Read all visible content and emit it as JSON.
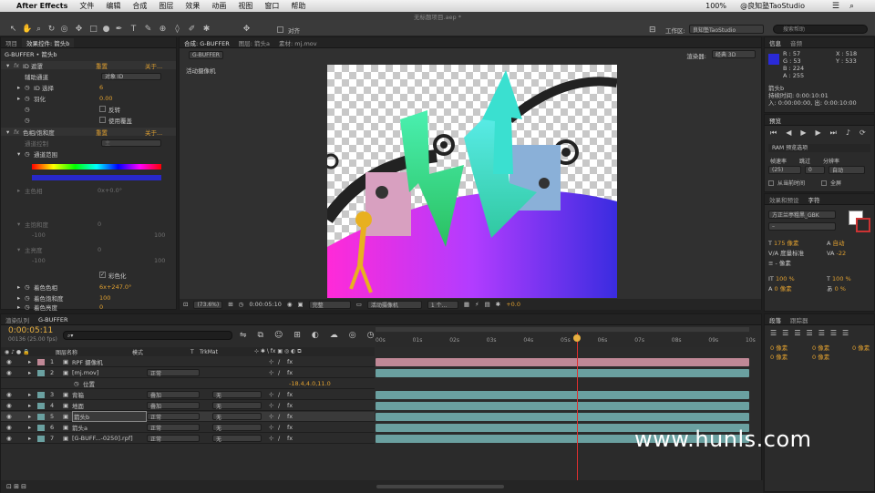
{
  "menubar": {
    "app": "After Effects",
    "items": [
      "文件",
      "编辑",
      "合成",
      "图层",
      "效果",
      "动画",
      "视图",
      "窗口",
      "帮助"
    ],
    "title": "无标题项目.aep *",
    "user": "@良知塾TaoStudio",
    "battery": "100%"
  },
  "toolbar": {
    "align_label": "对齐",
    "workspace_label": "工作区:",
    "workspace_value": "良知塾TaoStudio",
    "search_placeholder": "搜索帮助"
  },
  "effect_panel": {
    "tabs": [
      "项目",
      "效果控件: 箭头b"
    ],
    "breadcrumb": "G-BUFFER • 箭头b",
    "effects": [
      {
        "name": "ID 遮罩",
        "reset": "重置",
        "about": "关于..."
      },
      {
        "name": "色相/饱和度",
        "reset": "重置",
        "about": "关于..."
      }
    ],
    "id_matte": {
      "aux_channel_label": "辅助通道",
      "aux_channel_value": "对象 ID",
      "id_select_label": "ID 选择",
      "id_select_value": "6",
      "feather_label": "羽化",
      "feather_value": "0.00",
      "invert_label": "反转",
      "use_coverage_label": "使用覆盖"
    },
    "hue": {
      "channel_control_label": "通道控制",
      "channel_control_value": "主",
      "channel_range_label": "通道范围",
      "master_hue_label": "主色相",
      "master_hue_value": "0x+0.0°",
      "master_sat_label": "主饱和度",
      "master_sat_value": "0",
      "master_light_label": "主亮度",
      "master_light_value": "0",
      "scale_min": "-100",
      "scale_max": "100",
      "colorize_label": "彩色化",
      "colorize_hue_label": "着色色相",
      "colorize_hue_value": "6x+247.0°",
      "colorize_sat_label": "着色饱和度",
      "colorize_sat_value": "100",
      "colorize_light_label": "着色亮度",
      "colorize_light_value": "0"
    }
  },
  "comp_panel": {
    "tabs": [
      "合成: G-BUFFER",
      "图层: 箭头a",
      "素材: mj.mov"
    ],
    "comp_name": "G-BUFFER",
    "renderer_label": "渲染器:",
    "renderer_value": "经典 3D",
    "camera_label": "活动摄像机",
    "footer": {
      "zoom": "(73.6%)",
      "timecode": "0:00:05:10",
      "quality": "完整",
      "camera": "活动摄像机",
      "views": "1 个...",
      "exposure": "+0.0"
    }
  },
  "info_panel": {
    "tabs": [
      "信息",
      "音频"
    ],
    "color_swatch": "#2a2ad8",
    "r": "R : 57",
    "g": "G : 53",
    "b": "B : 224",
    "a": "A : 255",
    "x": "X : 518",
    "y": "Y : 533",
    "layer": "箭头b",
    "duration": "持续时间: 0:00:10:01",
    "in_out": "入: 0:00:00:00, 出: 0:00:10:00"
  },
  "preview_panel": {
    "tabs": [
      "预览"
    ],
    "ram_options": "RAM 预览选项",
    "frame_rate_label": "帧速率",
    "skip_label": "跳过",
    "resolution_label": "分辨率",
    "frame_rate_value": "(25)",
    "skip_value": "0",
    "resolution_value": "自动",
    "from_current_label": "从当前时间",
    "full_screen_label": "全屏"
  },
  "char_panel": {
    "tabs": [
      "效果和预设",
      "字符"
    ],
    "font": "方正兰亭粗黑_GBK",
    "size": "175 像素",
    "leading": "自动",
    "kerning": "度量标准",
    "tracking": "-22",
    "stroke": "- 像素",
    "scale_v": "100 %",
    "scale_h": "100 %",
    "baseline": "0 像素",
    "tsume": "0 %"
  },
  "para_panel": {
    "tabs": [
      "段落",
      "跟踪器"
    ],
    "values": [
      "0 像素",
      "0 像素",
      "0 像素",
      "0 像素",
      "0 像素"
    ]
  },
  "timeline": {
    "tabs": [
      "渲染队列",
      "G-BUFFER"
    ],
    "timecode": "0:00:05:11",
    "frame_info": "00136 (25.00 fps)",
    "columns": {
      "name": "图层名称",
      "mode": "模式",
      "t": "T",
      "trkmat": "TrkMat"
    },
    "ruler": [
      "00s",
      "01s",
      "02s",
      "03s",
      "04s",
      "05s",
      "06s",
      "07s",
      "08s",
      "09s",
      "10s"
    ],
    "playhead_seconds": 5.44,
    "layers": [
      {
        "num": "1",
        "name": "RPF 摄像机",
        "mode": "",
        "trk": "",
        "color": "#c08896",
        "bar": "#c08896"
      },
      {
        "num": "2",
        "name": "[mj.mov]",
        "mode": "正常",
        "trk": "",
        "color": "#6aa0a0",
        "bar": "#6aa0a0"
      },
      {
        "num": "3",
        "name": "背箱",
        "mode": "叠加",
        "trk": "无",
        "color": "#6aa0a0",
        "bar": "#6aa0a0"
      },
      {
        "num": "4",
        "name": "地面",
        "mode": "叠加",
        "trk": "无",
        "color": "#6aa0a0",
        "bar": "#6aa0a0"
      },
      {
        "num": "5",
        "name": "箭头b",
        "mode": "正常",
        "trk": "无",
        "color": "#6aa0a0",
        "bar": "#6aa0a0"
      },
      {
        "num": "6",
        "name": "箭头a",
        "mode": "正常",
        "trk": "无",
        "color": "#6aa0a0",
        "bar": "#6aa0a0"
      },
      {
        "num": "7",
        "name": "[G-BUFF...-0250].rpf]",
        "mode": "正常",
        "trk": "无",
        "color": "#6aa0a0",
        "bar": "#6aa0a0"
      }
    ],
    "position_label": "位置",
    "position_value": "-18.4,4.0,11.0"
  },
  "watermark": "www.hunls.com"
}
